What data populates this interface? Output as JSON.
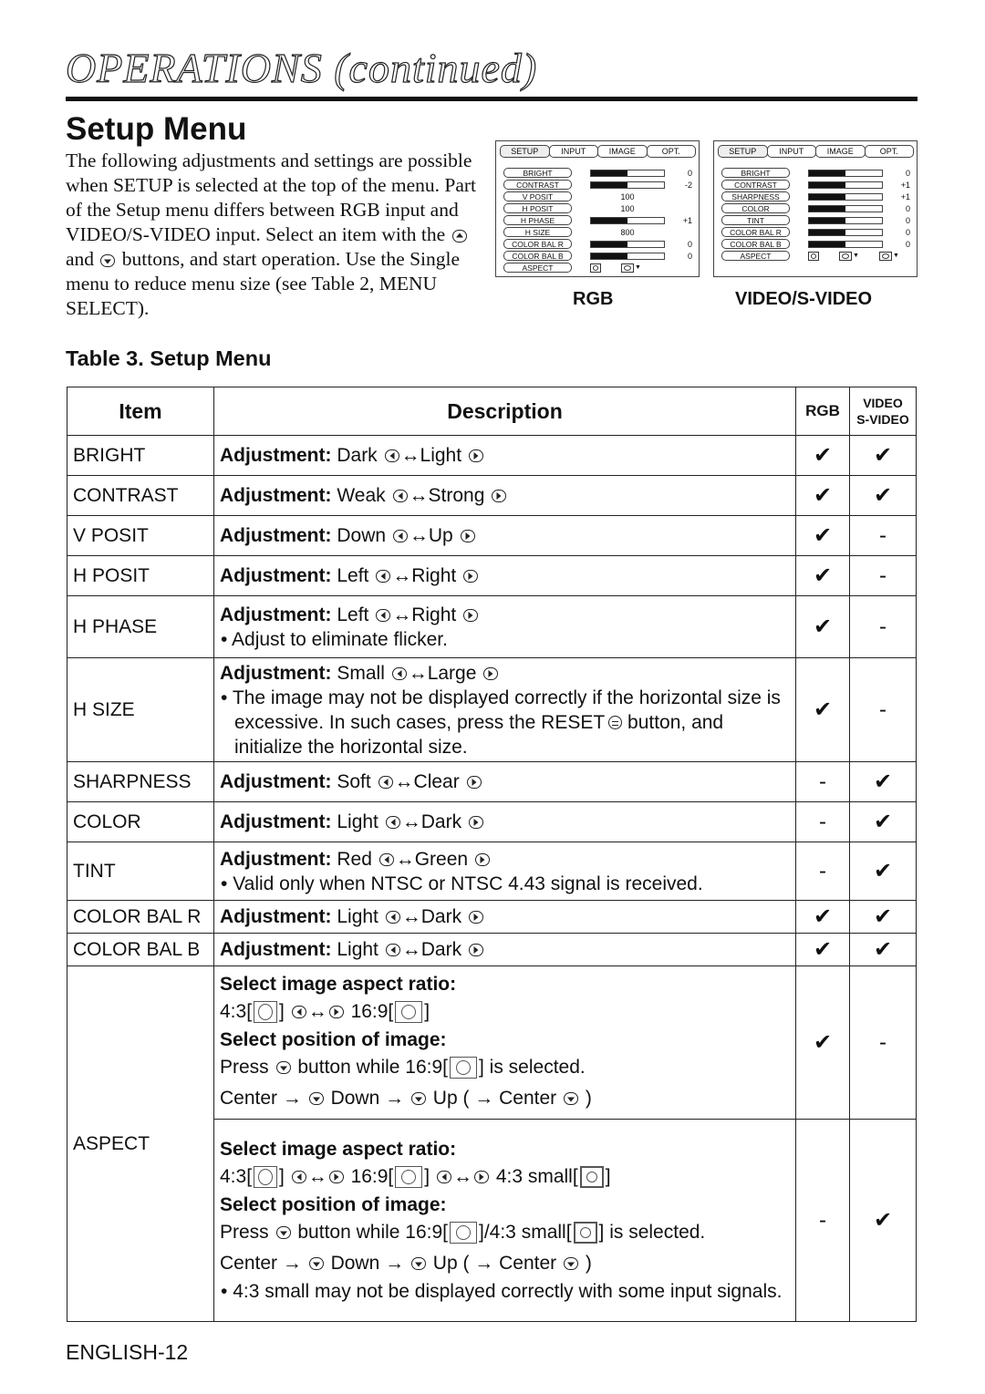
{
  "header": {
    "title": "OPERATIONS (continued)"
  },
  "section_title": "Setup Menu",
  "intro": {
    "part1": "The following adjustments and settings are possible when SETUP is selected at the top of the menu. Part of the Setup menu differs between RGB input and VIDEO/S-VIDEO input. Select an item with the",
    "and": "and",
    "part2": "buttons, and start operation. Use the Single menu to reduce menu size (see Table 2, MENU SELECT).",
    "up_icon": "up-button-icon",
    "down_icon": "down-button-icon"
  },
  "osd_rgb": {
    "caption": "RGB",
    "tabs": [
      "SETUP",
      "INPUT",
      "IMAGE",
      "OPT."
    ],
    "rows": [
      {
        "label": "BRIGHT",
        "type": "bar",
        "level": 0.5,
        "value": "0"
      },
      {
        "label": "CONTRAST",
        "type": "bar",
        "level": 0.5,
        "value": "-2"
      },
      {
        "label": "V POSIT",
        "type": "num",
        "value": "100"
      },
      {
        "label": "H POSIT",
        "type": "num",
        "value": "100"
      },
      {
        "label": "H PHASE",
        "type": "bar",
        "level": 0.5,
        "value": "+1"
      },
      {
        "label": "H SIZE",
        "type": "num",
        "value": "800"
      },
      {
        "label": "COLOR BAL R",
        "type": "bar",
        "level": 0.5,
        "value": "0"
      },
      {
        "label": "COLOR BAL B",
        "type": "bar",
        "level": 0.5,
        "value": "0"
      },
      {
        "label": "ASPECT",
        "type": "aspect",
        "icons": [
          "aspect-4-3-icon",
          "aspect-16-9-icon"
        ]
      }
    ]
  },
  "osd_video": {
    "caption": "VIDEO/S-VIDEO",
    "tabs": [
      "SETUP",
      "INPUT",
      "IMAGE",
      "OPT."
    ],
    "rows": [
      {
        "label": "BRIGHT",
        "type": "bar",
        "level": 0.5,
        "value": "0"
      },
      {
        "label": "CONTRAST",
        "type": "bar",
        "level": 0.5,
        "value": "+1"
      },
      {
        "label": "SHARPNESS",
        "type": "bar",
        "level": 0.5,
        "value": "+1"
      },
      {
        "label": "COLOR",
        "type": "bar",
        "level": 0.5,
        "value": "0"
      },
      {
        "label": "TINT",
        "type": "bar",
        "level": 0.5,
        "value": "0"
      },
      {
        "label": "COLOR BAL  R",
        "type": "bar",
        "level": 0.5,
        "value": "0"
      },
      {
        "label": "COLOR BAL  B",
        "type": "bar",
        "level": 0.5,
        "value": "0"
      },
      {
        "label": "ASPECT",
        "type": "aspect",
        "icons": [
          "aspect-4-3-icon",
          "aspect-16-9-icon",
          "aspect-4-3-small-icon"
        ]
      }
    ]
  },
  "table": {
    "caption": "Table 3. Setup Menu",
    "headers": {
      "item": "Item",
      "description": "Description",
      "rgb": "RGB",
      "video1": "VIDEO",
      "video2": "S-VIDEO"
    },
    "check": "✔",
    "dash": "-",
    "adj_label": "Adjustment:",
    "arrow": "↔",
    "rows": [
      {
        "item": "BRIGHT",
        "left": "Dark",
        "right": "Light",
        "rgb": "✔",
        "video": "✔"
      },
      {
        "item": "CONTRAST",
        "left": "Weak",
        "right": "Strong",
        "rgb": "✔",
        "video": "✔"
      },
      {
        "item": "V POSIT",
        "left": "Down",
        "right": "Up",
        "rgb": "✔",
        "video": "-"
      },
      {
        "item": "H POSIT",
        "left": "Left",
        "right": "Right",
        "rgb": "✔",
        "video": "-"
      },
      {
        "item": "H PHASE",
        "left": "Left",
        "right": "Right",
        "note": "Adjust to eliminate flicker.",
        "rgb": "✔",
        "video": "-"
      },
      {
        "item": "H SIZE",
        "left": "Small",
        "right": "Large",
        "note1": "The image may not be displayed correctly if the horizontal size is excessive. In such cases, press the RESET",
        "note2": "button, and initialize the horizontal size.",
        "rgb": "✔",
        "video": "-"
      },
      {
        "item": "SHARPNESS",
        "left": "Soft",
        "right": "Clear",
        "rgb": "-",
        "video": "✔"
      },
      {
        "item": "COLOR",
        "left": "Light",
        "right": "Dark",
        "rgb": "-",
        "video": "✔"
      },
      {
        "item": "TINT",
        "left": "Red",
        "right": "Green",
        "note": "Valid only when NTSC or NTSC 4.43 signal is received.",
        "rgb": "-",
        "video": "✔"
      },
      {
        "item": "COLOR BAL R",
        "left": "Light",
        "right": "Dark",
        "rgb": "✔",
        "video": "✔"
      },
      {
        "item": "COLOR BAL B",
        "left": "Light",
        "right": "Dark",
        "rgb": "✔",
        "video": "✔"
      }
    ],
    "aspect": {
      "item": "ASPECT",
      "rgb_block": {
        "h1": "Select image aspect ratio:",
        "r43": "4:3[",
        "close": "]",
        "r169": "16:9[",
        "h2": "Select position of image:",
        "press": "Press",
        "while": "button while 16:9[",
        "selected": "] is selected.",
        "center": "Center →",
        "down": "Down →",
        "up": "Up ( → Center",
        "end": ")",
        "rgb": "✔",
        "video": "-"
      },
      "video_block": {
        "h1": "Select image aspect ratio:",
        "r43": "4:3[",
        "close": "]",
        "r169": "16:9[",
        "r43s": "4:3 small[",
        "h2": "Select position of image:",
        "press": "Press",
        "while": "button while 16:9[",
        "mid": "]/4:3 small[",
        "selected": "] is selected.",
        "center": "Center →",
        "down": "Down →",
        "up": "Up ( → Center",
        "end": ")",
        "note": "4:3 small may not be displayed correctly with some input signals.",
        "rgb": "-",
        "video": "✔"
      }
    }
  },
  "footer": {
    "page": "ENGLISH-12"
  }
}
